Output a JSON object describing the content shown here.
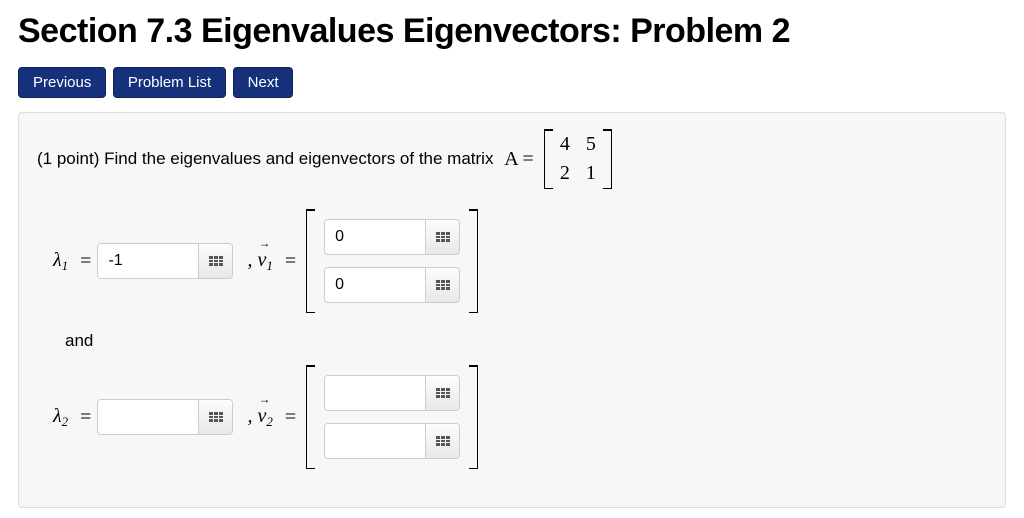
{
  "title": "Section 7.3 Eigenvalues Eigenvectors: Problem 2",
  "nav": {
    "prev": "Previous",
    "list": "Problem List",
    "next": "Next"
  },
  "problem": {
    "points_label": "(1 point)",
    "prompt_text": "Find the eigenvalues and eigenvectors of the matrix",
    "matrix_label": "A =",
    "matrix": [
      [
        "4",
        "5"
      ],
      [
        "2",
        "1"
      ]
    ],
    "lambda1_label": "λ",
    "lambda1_sub": "1",
    "eq": " = ",
    "lambda1_value": "-1",
    "v1_label": "v",
    "v1_sub": "1",
    "v1_values": [
      "0",
      "0"
    ],
    "and": "and",
    "lambda2_label": "λ",
    "lambda2_sub": "2",
    "lambda2_value": "",
    "v2_label": "v",
    "v2_sub": "2",
    "v2_values": [
      "",
      ""
    ]
  }
}
